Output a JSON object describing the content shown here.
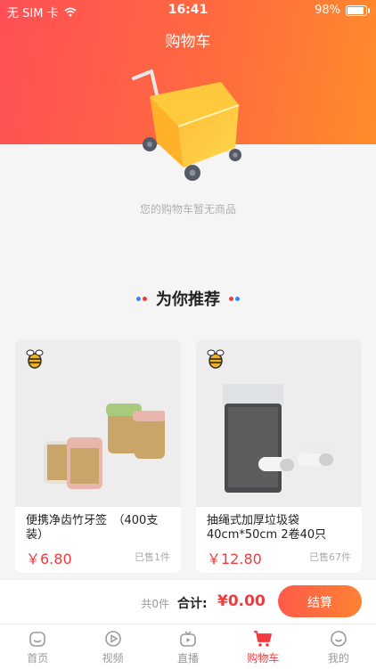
{
  "status_bar": {
    "carrier": "无 SIM 卡",
    "time": "16:41",
    "battery": "98%"
  },
  "header": {
    "title": "购物车"
  },
  "empty": {
    "text": "您的购物车暂无商品"
  },
  "recommend": {
    "title": "为你推荐"
  },
  "products": [
    {
      "name": "便携净齿竹牙签　（400支装）",
      "price": "￥6.80",
      "sold": "已售1件"
    },
    {
      "name": "抽绳式加厚垃圾袋40cm*50cm 2卷40只",
      "price": "￥12.80",
      "sold": "已售67件"
    }
  ],
  "checkout": {
    "count": "共0件",
    "total_label": "合计:",
    "total": "¥0.00",
    "button": "结算"
  },
  "tabs": [
    {
      "label": "首页",
      "icon": "home-icon"
    },
    {
      "label": "视频",
      "icon": "video-icon"
    },
    {
      "label": "直播",
      "icon": "live-icon"
    },
    {
      "label": "购物车",
      "icon": "cart-icon"
    },
    {
      "label": "我的",
      "icon": "profile-icon"
    }
  ],
  "colors": {
    "accent": "#f2393d",
    "header_start": "#ff4f56",
    "header_end": "#ff8c2a"
  }
}
